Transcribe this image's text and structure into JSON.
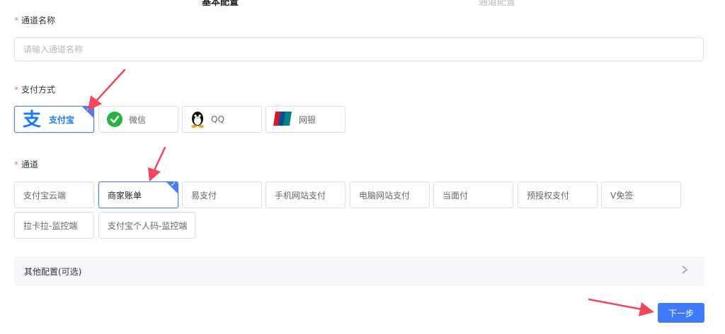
{
  "steps": {
    "step1": "基本配置",
    "step2": "通道配置"
  },
  "form": {
    "channel_name": {
      "required_mark": "*",
      "label": "通道名称",
      "placeholder": "请输入通道名称",
      "value": ""
    },
    "payment_method": {
      "required_mark": "*",
      "label": "支付方式",
      "options": [
        {
          "label": "支付宝",
          "icon": "alipay-icon",
          "selected": true
        },
        {
          "label": "微信",
          "icon": "wechat-icon",
          "selected": false
        },
        {
          "label": "QQ",
          "icon": "qq-penguin-icon",
          "selected": false
        },
        {
          "label": "网银",
          "icon": "unionpay-icon",
          "selected": false
        }
      ]
    },
    "channel": {
      "required_mark": "*",
      "label": "通道",
      "options": [
        {
          "label": "支付宝云端",
          "selected": false
        },
        {
          "label": "商家账单",
          "selected": true
        },
        {
          "label": "易支付",
          "selected": false
        },
        {
          "label": "手机网站支付",
          "selected": false
        },
        {
          "label": "电脑网站支付",
          "selected": false
        },
        {
          "label": "当面付",
          "selected": false
        },
        {
          "label": "预授权支付",
          "selected": false
        },
        {
          "label": "V免签",
          "selected": false
        },
        {
          "label": "拉卡拉-监控端",
          "selected": false
        },
        {
          "label": "支付宝个人码-监控端",
          "selected": false
        }
      ]
    },
    "other_config": {
      "label": "其他配置(可选)"
    }
  },
  "actions": {
    "next_label": "下一步"
  },
  "colors": {
    "accent": "#3e7bfa",
    "selected_border": "#4c7fee",
    "required": "#f56c6c",
    "annotation_arrow": "#f3465a"
  }
}
